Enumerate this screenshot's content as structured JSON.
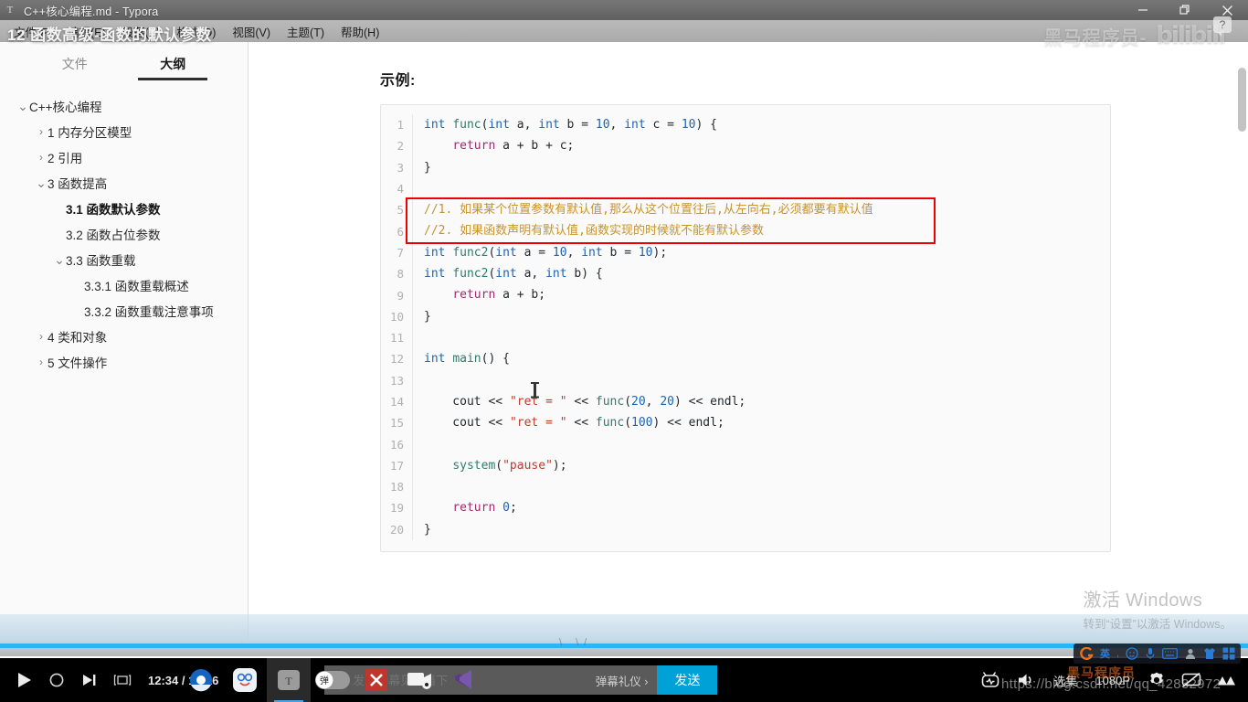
{
  "window": {
    "app_icon": "typora-icon",
    "title": "C++核心编程.md - Typora",
    "minimize_label": "—",
    "maximize_label": "❐",
    "close_label": "✕"
  },
  "menubar": {
    "items": [
      {
        "label": "文件(F)"
      },
      {
        "label": "编辑(E)"
      },
      {
        "label": "段落(P)"
      },
      {
        "label": "格式(O)"
      },
      {
        "label": "视图(V)"
      },
      {
        "label": "主题(T)"
      },
      {
        "label": "帮助(H)"
      }
    ]
  },
  "video_overlay": {
    "title": "12 函数高级-函数的默认参数",
    "uploader_watermark": "黑马程序员-",
    "bili_logo": "bilibili",
    "help_badge": "?"
  },
  "sidebar": {
    "tabs": [
      {
        "label": "文件",
        "active": false
      },
      {
        "label": "大纲",
        "active": true
      }
    ],
    "outline": [
      {
        "label": "C++核心编程",
        "indent": 0,
        "caret": "down",
        "bold": false
      },
      {
        "label": "1 内存分区模型",
        "indent": 1,
        "caret": "right",
        "bold": false
      },
      {
        "label": "2 引用",
        "indent": 1,
        "caret": "right",
        "bold": false
      },
      {
        "label": "3 函数提高",
        "indent": 1,
        "caret": "down",
        "bold": false
      },
      {
        "label": "3.1 函数默认参数",
        "indent": 2,
        "caret": "none",
        "bold": true
      },
      {
        "label": "3.2 函数占位参数",
        "indent": 2,
        "caret": "none",
        "bold": false
      },
      {
        "label": "3.3 函数重载",
        "indent": 2,
        "caret": "down",
        "bold": false
      },
      {
        "label": "3.3.1 函数重载概述",
        "indent": 3,
        "caret": "none",
        "bold": false
      },
      {
        "label": "3.3.2 函数重载注意事项",
        "indent": 3,
        "caret": "none",
        "bold": false
      },
      {
        "label": "4 类和对象",
        "indent": 1,
        "caret": "right",
        "bold": false
      },
      {
        "label": "5 文件操作",
        "indent": 1,
        "caret": "right",
        "bold": false
      }
    ]
  },
  "document": {
    "heading": "示例:",
    "code_language": "c++",
    "code_lines": [
      {
        "n": "1",
        "tokens": [
          {
            "t": "int ",
            "c": "type"
          },
          {
            "t": "func",
            "c": "fn"
          },
          {
            "t": "(",
            "c": "plain"
          },
          {
            "t": "int",
            "c": "type"
          },
          {
            "t": " a, ",
            "c": "plain"
          },
          {
            "t": "int",
            "c": "type"
          },
          {
            "t": " b ",
            "c": "plain"
          },
          {
            "t": "=",
            "c": "op"
          },
          {
            "t": " ",
            "c": "plain"
          },
          {
            "t": "10",
            "c": "num"
          },
          {
            "t": ", ",
            "c": "plain"
          },
          {
            "t": "int",
            "c": "type"
          },
          {
            "t": " c ",
            "c": "plain"
          },
          {
            "t": "=",
            "c": "op"
          },
          {
            "t": " ",
            "c": "plain"
          },
          {
            "t": "10",
            "c": "num"
          },
          {
            "t": ") {",
            "c": "plain"
          }
        ]
      },
      {
        "n": "2",
        "tokens": [
          {
            "t": "    ",
            "c": "plain"
          },
          {
            "t": "return",
            "c": "kw"
          },
          {
            "t": " a ",
            "c": "plain"
          },
          {
            "t": "+",
            "c": "op"
          },
          {
            "t": " b ",
            "c": "plain"
          },
          {
            "t": "+",
            "c": "op"
          },
          {
            "t": " c;",
            "c": "plain"
          }
        ]
      },
      {
        "n": "3",
        "tokens": [
          {
            "t": "}",
            "c": "plain"
          }
        ]
      },
      {
        "n": "4",
        "tokens": [
          {
            "t": "",
            "c": "plain"
          }
        ]
      },
      {
        "n": "5",
        "tokens": [
          {
            "t": "//1. 如果某个位置参数有默认值,那么从这个位置往后,从左向右,必须都要有默认值",
            "c": "cmt"
          }
        ]
      },
      {
        "n": "6",
        "tokens": [
          {
            "t": "//2. 如果函数声明有默认值,函数实现的时候就不能有默认参数",
            "c": "cmt"
          }
        ]
      },
      {
        "n": "7",
        "tokens": [
          {
            "t": "int ",
            "c": "type"
          },
          {
            "t": "func2",
            "c": "fn"
          },
          {
            "t": "(",
            "c": "plain"
          },
          {
            "t": "int",
            "c": "type"
          },
          {
            "t": " a ",
            "c": "plain"
          },
          {
            "t": "=",
            "c": "op"
          },
          {
            "t": " ",
            "c": "plain"
          },
          {
            "t": "10",
            "c": "num"
          },
          {
            "t": ", ",
            "c": "plain"
          },
          {
            "t": "int",
            "c": "type"
          },
          {
            "t": " b ",
            "c": "plain"
          },
          {
            "t": "=",
            "c": "op"
          },
          {
            "t": " ",
            "c": "plain"
          },
          {
            "t": "10",
            "c": "num"
          },
          {
            "t": ");",
            "c": "plain"
          }
        ]
      },
      {
        "n": "8",
        "tokens": [
          {
            "t": "int ",
            "c": "type"
          },
          {
            "t": "func2",
            "c": "fn"
          },
          {
            "t": "(",
            "c": "plain"
          },
          {
            "t": "int",
            "c": "type"
          },
          {
            "t": " a, ",
            "c": "plain"
          },
          {
            "t": "int",
            "c": "type"
          },
          {
            "t": " b) {",
            "c": "plain"
          }
        ]
      },
      {
        "n": "9",
        "tokens": [
          {
            "t": "    ",
            "c": "plain"
          },
          {
            "t": "return",
            "c": "kw"
          },
          {
            "t": " a ",
            "c": "plain"
          },
          {
            "t": "+",
            "c": "op"
          },
          {
            "t": " b;",
            "c": "plain"
          }
        ]
      },
      {
        "n": "10",
        "tokens": [
          {
            "t": "}",
            "c": "plain"
          }
        ]
      },
      {
        "n": "11",
        "tokens": [
          {
            "t": "",
            "c": "plain"
          }
        ]
      },
      {
        "n": "12",
        "tokens": [
          {
            "t": "int ",
            "c": "type"
          },
          {
            "t": "main",
            "c": "fn"
          },
          {
            "t": "() {",
            "c": "plain"
          }
        ]
      },
      {
        "n": "13",
        "tokens": [
          {
            "t": "",
            "c": "plain"
          }
        ]
      },
      {
        "n": "14",
        "tokens": [
          {
            "t": "    cout ",
            "c": "plain"
          },
          {
            "t": "<<",
            "c": "op"
          },
          {
            "t": " ",
            "c": "plain"
          },
          {
            "t": "\"ret = \"",
            "c": "str"
          },
          {
            "t": " ",
            "c": "plain"
          },
          {
            "t": "<<",
            "c": "op"
          },
          {
            "t": " ",
            "c": "plain"
          },
          {
            "t": "func",
            "c": "fn"
          },
          {
            "t": "(",
            "c": "plain"
          },
          {
            "t": "20",
            "c": "num"
          },
          {
            "t": ", ",
            "c": "plain"
          },
          {
            "t": "20",
            "c": "num"
          },
          {
            "t": ") ",
            "c": "plain"
          },
          {
            "t": "<<",
            "c": "op"
          },
          {
            "t": " endl;",
            "c": "plain"
          }
        ]
      },
      {
        "n": "15",
        "tokens": [
          {
            "t": "    cout ",
            "c": "plain"
          },
          {
            "t": "<<",
            "c": "op"
          },
          {
            "t": " ",
            "c": "plain"
          },
          {
            "t": "\"ret = \"",
            "c": "str"
          },
          {
            "t": " ",
            "c": "plain"
          },
          {
            "t": "<<",
            "c": "op"
          },
          {
            "t": " ",
            "c": "plain"
          },
          {
            "t": "func",
            "c": "fn"
          },
          {
            "t": "(",
            "c": "plain"
          },
          {
            "t": "100",
            "c": "num"
          },
          {
            "t": ") ",
            "c": "plain"
          },
          {
            "t": "<<",
            "c": "op"
          },
          {
            "t": " endl;",
            "c": "plain"
          }
        ]
      },
      {
        "n": "16",
        "tokens": [
          {
            "t": "",
            "c": "plain"
          }
        ]
      },
      {
        "n": "17",
        "tokens": [
          {
            "t": "    ",
            "c": "plain"
          },
          {
            "t": "system",
            "c": "fn"
          },
          {
            "t": "(",
            "c": "plain"
          },
          {
            "t": "\"pause\"",
            "c": "str"
          },
          {
            "t": ");",
            "c": "plain"
          }
        ]
      },
      {
        "n": "18",
        "tokens": [
          {
            "t": "",
            "c": "plain"
          }
        ]
      },
      {
        "n": "19",
        "tokens": [
          {
            "t": "    ",
            "c": "plain"
          },
          {
            "t": "return",
            "c": "kw"
          },
          {
            "t": " ",
            "c": "plain"
          },
          {
            "t": "0",
            "c": "num"
          },
          {
            "t": ";",
            "c": "plain"
          }
        ]
      },
      {
        "n": "20",
        "tokens": [
          {
            "t": "}",
            "c": "plain"
          }
        ]
      }
    ],
    "annotation_box_color": "#ee0000"
  },
  "player": {
    "play_icon": "play-icon",
    "record_icon": "circle-icon",
    "next_icon": "next-track-icon",
    "wide_icon": "widescreen-icon",
    "time_current": "12:34",
    "time_separator": "/",
    "time_total": "13:16",
    "progress_percent": 100,
    "danmaku": {
      "style_icon": "font-style-A-icon",
      "placeholder": "发个弹幕见证当下",
      "etiquette_link": "弹幕礼仪 ›",
      "send_label": "发送"
    },
    "right_controls": [
      {
        "name": "tv-icon",
        "label": ""
      },
      {
        "name": "volume-icon",
        "label": ""
      },
      {
        "name": "episodes",
        "label": "选集"
      },
      {
        "name": "quality",
        "label": "1080P"
      },
      {
        "name": "gear-icon",
        "label": ""
      },
      {
        "name": "danmaku-off-icon",
        "label": ""
      },
      {
        "name": "fullscreen-icon",
        "label": ""
      }
    ]
  },
  "taskbar": {
    "icons": [
      {
        "name": "chrome-like-icon",
        "glyph": ""
      },
      {
        "name": "baidu-netdisk-icon",
        "glyph": ""
      },
      {
        "name": "typora-icon",
        "glyph": "T",
        "active": true
      },
      {
        "name": "danmaku-toggle-icon",
        "glyph": "弹"
      },
      {
        "name": "xmind-icon",
        "glyph": "X"
      },
      {
        "name": "camtasia-icon",
        "glyph": ""
      },
      {
        "name": "vscode-icon",
        "glyph": ""
      }
    ]
  },
  "ime": {
    "items": [
      "sogou-logo-icon",
      "中英-icon",
      "comma-icon",
      "smiley-icon",
      "microphone-icon",
      "keyboard-icon",
      "user-icon",
      "skin-icon",
      "apps-icon"
    ]
  },
  "watermarks": {
    "windows_activate_title": "激活 Windows",
    "windows_activate_sub": "转到“设置”以激活 Windows。",
    "csdn_url": "https://blog.csdn.net/qq_42832972",
    "bottom_brand": "黑马程序员"
  },
  "colors": {
    "accent": "#00a1d6",
    "progress": "#29b6f6",
    "annotation": "#ee0000",
    "sidebar_bg": "#fafafa"
  }
}
